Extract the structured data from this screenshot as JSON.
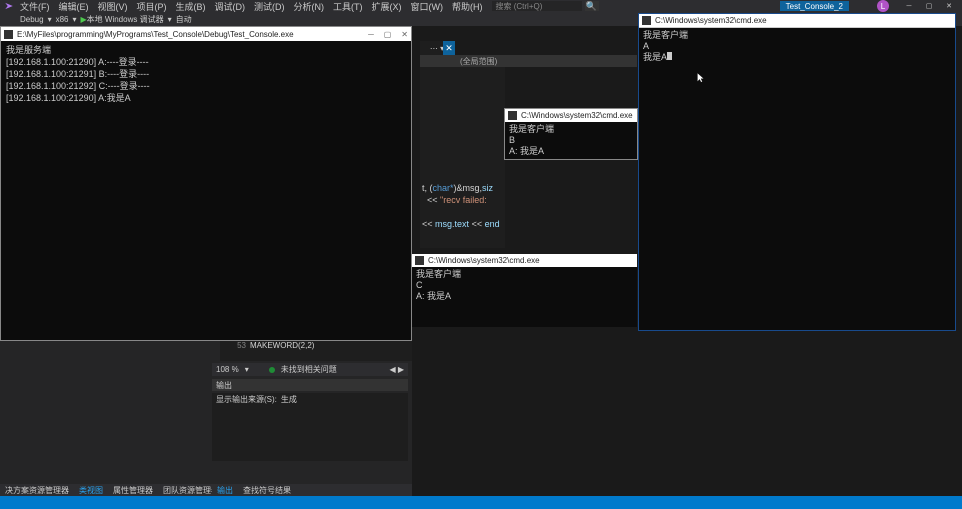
{
  "menu": {
    "items": [
      "文件(F)",
      "编辑(E)",
      "视图(V)",
      "项目(P)",
      "生成(B)",
      "调试(D)",
      "测试(D)",
      "分析(N)",
      "工具(T)",
      "扩展(X)",
      "窗口(W)",
      "帮助(H)"
    ],
    "search_placeholder": "搜索 (Ctrl+Q)",
    "vs_tab": "Test_Console_2",
    "avatar": "L"
  },
  "toolbar": {
    "config": "Debug",
    "platform": "x86",
    "action": "本地 Windows 调试器",
    "extra": "自动"
  },
  "console1": {
    "title": "E:\\MyFiles\\programming\\MyPrograms\\Test_Console\\Debug\\Test_Console.exe",
    "lines": [
      "我是服务端",
      "[192.168.1.100:21290] A:----登录----",
      "[192.168.1.100:21291] B:----登录----",
      "[192.168.1.100:21292] C:----登录----",
      "[192.168.1.100:21290] A:我是A"
    ]
  },
  "editor": {
    "scope": "(全局范围)",
    "code_lines": [
      "t, (char*)&msg,siz",
      "  << \"recv failed:",
      "",
      "<< msg.text << end"
    ],
    "line_no": "53",
    "under_code": "MAKEWORD(2,2)"
  },
  "zoom": {
    "pct": "108 %",
    "msg": "未找到相关问题"
  },
  "output": {
    "hdr": "输出",
    "from_label": "显示输出来源(S):",
    "from_value": "生成"
  },
  "left_tabs": {
    "t1": "决方案资源管理器",
    "t2": "类视图",
    "t3": "属性管理器",
    "t4": "团队资源管理器",
    "r1": "输出",
    "r2": "查找符号结果"
  },
  "cmd2": {
    "title": "C:\\Windows\\system32\\cmd.exe",
    "lines": [
      "我是客户端",
      "B",
      "A: 我是A"
    ]
  },
  "cmd3": {
    "title": "C:\\Windows\\system32\\cmd.exe",
    "lines": [
      "我是客户端",
      "C",
      "A: 我是A"
    ]
  },
  "cmd4": {
    "title": "C:\\Windows\\system32\\cmd.exe",
    "lines": [
      "我是客户端",
      "A",
      "我是A"
    ]
  }
}
